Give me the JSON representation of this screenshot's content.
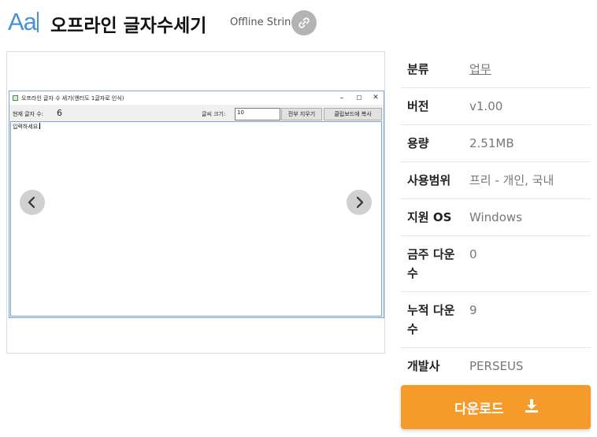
{
  "header": {
    "logo_text": "Aa",
    "title": "오프라인 글자수세기",
    "subtitle": "Offline String"
  },
  "screenshot": {
    "window_title": "오프라인 글자 수 세기(엔터도 1글자로 인식)",
    "count_label": "현재 글자 수:",
    "count_value": "6",
    "font_size_label": "글씨 크기:",
    "font_size_value": "10",
    "clear_button": "전부 지우기",
    "copy_button": "클립보드에 복사",
    "textarea_text": "입력하세요.",
    "controls": {
      "minimize": "–",
      "maximize": "☐",
      "close": "✕"
    }
  },
  "specs": [
    {
      "key": "분류",
      "value": "업무"
    },
    {
      "key": "버전",
      "value": "v1.00"
    },
    {
      "key": "용량",
      "value": "2.51MB"
    },
    {
      "key": "사용범위",
      "value": "프리 - 개인, 국내"
    },
    {
      "key": "지원 OS",
      "value": "Windows"
    },
    {
      "key": "금주 다운수",
      "value": "0"
    },
    {
      "key": "누적 다운수",
      "value": "9"
    },
    {
      "key": "개발사",
      "value": "PERSEUS"
    }
  ],
  "download": {
    "label": "다운로드"
  },
  "colors": {
    "accent": "#f59b2c",
    "logo": "#4a90d9",
    "link_button": "#b3b3b3"
  },
  "icons": [
    "link-icon",
    "chevron-left-icon",
    "chevron-right-icon",
    "download-icon"
  ]
}
